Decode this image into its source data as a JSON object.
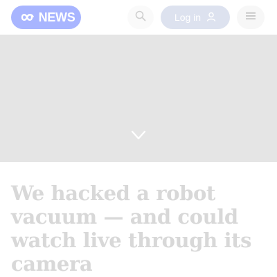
{
  "header": {
    "logo_text": "NEWS",
    "login_label": "Log in",
    "icons": {
      "logo": "abc-logo-icon",
      "search": "search-icon",
      "user": "user-icon",
      "menu": "hamburger-menu-icon",
      "hero_expand": "chevron-down-icon"
    }
  },
  "article": {
    "headline": "We hacked a robot vacuum — and could watch live through its camera"
  },
  "colors": {
    "logo_bg": "#a8b5ff",
    "login_bg": "#dde2ef",
    "hero_bg": "#e5e5e5",
    "headline": "#d8d8d8"
  }
}
